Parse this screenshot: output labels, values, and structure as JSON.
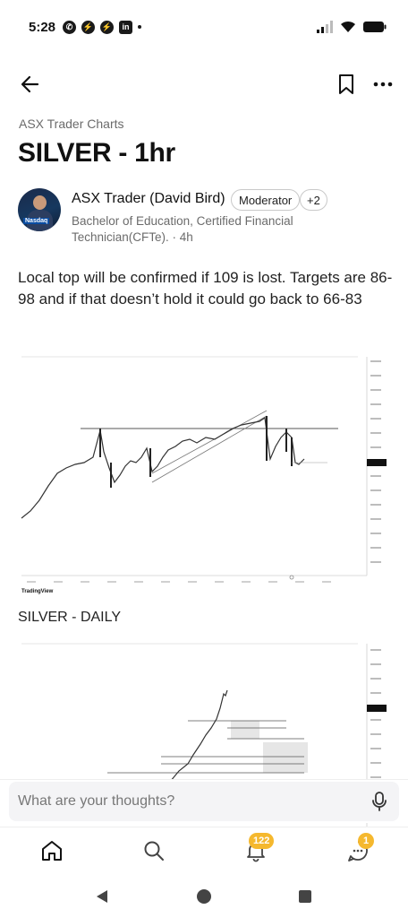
{
  "status_bar": {
    "time": "5:28",
    "left_icons": [
      "whatsapp-icon",
      "messenger-icon",
      "messenger-icon",
      "linkedin-icon",
      "dot-icon"
    ],
    "right_icons": [
      "signal-icon",
      "wifi-icon",
      "battery-icon"
    ]
  },
  "header": {
    "community": "ASX Trader Charts",
    "title": "SILVER - 1hr"
  },
  "author": {
    "name": "ASX Trader (David Bird)",
    "role_badge": "Moderator",
    "extra_badge": "+2",
    "meta": "Bachelor of Education, Certified Financial Technician(CFTe). · 4h",
    "avatar_logo": "Nasdaq"
  },
  "post": {
    "body": "Local top will be confirmed if 109 is lost. Targets are 86-98 and if that doesn’t hold it could go back to 66-83",
    "section2_title": "SILVER - DAILY"
  },
  "chart1_caption": "TradingView",
  "comment": {
    "placeholder": "What are your thoughts?"
  },
  "nav": {
    "notifications_badge": "122",
    "messages_badge": "1"
  },
  "colors": {
    "badge": "#f5b82e",
    "accent": "#111111"
  }
}
